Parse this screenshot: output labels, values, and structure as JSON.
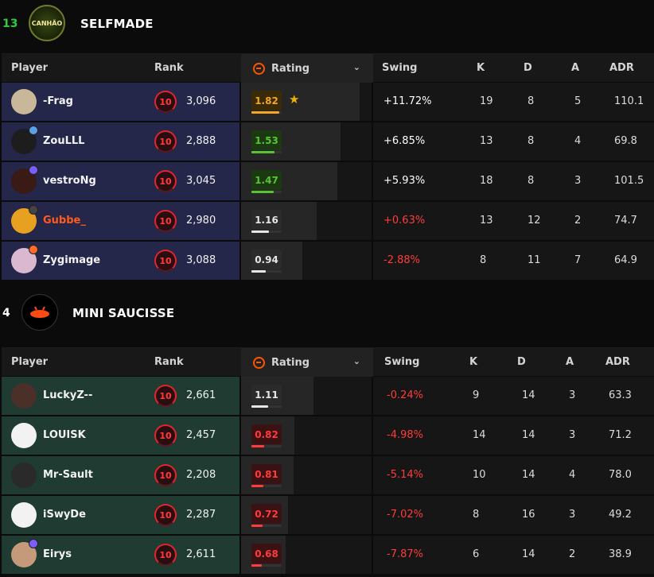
{
  "teams": [
    {
      "score": "13",
      "score_color": "#2ecc40",
      "logo_text": "CANHÃO",
      "name": "SELFMADE",
      "row_color": "#24264a",
      "headers": {
        "player": "Player",
        "rank": "Rank",
        "rating": "Rating",
        "swing": "Swing",
        "k": "K",
        "d": "D",
        "a": "A",
        "adr": "ADR"
      },
      "players": [
        {
          "name": "-Frag",
          "name_color": "#f2f2f2",
          "level": "10",
          "elo": "3,096",
          "rating": "1.82",
          "rating_tier": "gold",
          "star": "★",
          "swing": "+11.72%",
          "swing_sign": "pos",
          "k": "19",
          "d": "8",
          "a": "5",
          "adr": "110.1",
          "avatar_color": "#c9b79a",
          "badge_color": ""
        },
        {
          "name": "ZouLLL",
          "name_color": "#f2f2f2",
          "level": "10",
          "elo": "2,888",
          "rating": "1.53",
          "rating_tier": "green",
          "star": "",
          "swing": "+6.85%",
          "swing_sign": "pos",
          "k": "13",
          "d": "8",
          "a": "4",
          "adr": "69.8",
          "avatar_color": "#1d1d1d",
          "badge_color": "#5aa0e6"
        },
        {
          "name": "vestroNg",
          "name_color": "#f2f2f2",
          "level": "10",
          "elo": "3,045",
          "rating": "1.47",
          "rating_tier": "green",
          "star": "",
          "swing": "+5.93%",
          "swing_sign": "pos",
          "k": "18",
          "d": "8",
          "a": "3",
          "adr": "101.5",
          "avatar_color": "#3a1a14",
          "badge_color": "#7b5cff"
        },
        {
          "name": "Gubbe_",
          "name_color": "#ff5a1f",
          "level": "10",
          "elo": "2,980",
          "rating": "1.16",
          "rating_tier": "neutral",
          "star": "",
          "swing": "+0.63%",
          "swing_sign": "neg",
          "k": "13",
          "d": "12",
          "a": "2",
          "adr": "74.7",
          "avatar_color": "#e8a020",
          "badge_color": "#444"
        },
        {
          "name": "Zygimage",
          "name_color": "#f2f2f2",
          "level": "10",
          "elo": "3,088",
          "rating": "0.94",
          "rating_tier": "neutral",
          "star": "",
          "swing": "-2.88%",
          "swing_sign": "neg",
          "k": "8",
          "d": "11",
          "a": "7",
          "adr": "64.9",
          "avatar_color": "#d9b8d0",
          "badge_color": "#ff6a2a"
        }
      ]
    },
    {
      "score": "4",
      "score_color": "#ffffff",
      "logo_text": "",
      "name": "MINI SAUCISSE",
      "row_color": "#1f3b32",
      "headers": {
        "player": "Player",
        "rank": "Rank",
        "rating": "Rating",
        "swing": "Swing",
        "k": "K",
        "d": "D",
        "a": "A",
        "adr": "ADR"
      },
      "players": [
        {
          "name": "LuckyZ--",
          "name_color": "#f2f2f2",
          "level": "10",
          "elo": "2,661",
          "rating": "1.11",
          "rating_tier": "neutral",
          "star": "",
          "swing": "-0.24%",
          "swing_sign": "neg",
          "k": "9",
          "d": "14",
          "a": "3",
          "adr": "63.3",
          "avatar_color": "#4a3028",
          "badge_color": ""
        },
        {
          "name": "LOUISK",
          "name_color": "#f2f2f2",
          "level": "10",
          "elo": "2,457",
          "rating": "0.82",
          "rating_tier": "red",
          "star": "",
          "swing": "-4.98%",
          "swing_sign": "neg",
          "k": "14",
          "d": "14",
          "a": "3",
          "adr": "71.2",
          "avatar_color": "#f2f2f2",
          "badge_color": ""
        },
        {
          "name": "Mr-Sault",
          "name_color": "#f2f2f2",
          "level": "10",
          "elo": "2,208",
          "rating": "0.81",
          "rating_tier": "red",
          "star": "",
          "swing": "-5.14%",
          "swing_sign": "neg",
          "k": "10",
          "d": "14",
          "a": "4",
          "adr": "78.0",
          "avatar_color": "#2a2a2a",
          "badge_color": ""
        },
        {
          "name": "iSwyDe",
          "name_color": "#f2f2f2",
          "level": "10",
          "elo": "2,287",
          "rating": "0.72",
          "rating_tier": "red",
          "star": "",
          "swing": "-7.02%",
          "swing_sign": "neg",
          "k": "8",
          "d": "16",
          "a": "3",
          "adr": "49.2",
          "avatar_color": "#f2f2f2",
          "badge_color": ""
        },
        {
          "name": "Eirys",
          "name_color": "#f2f2f2",
          "level": "10",
          "elo": "2,611",
          "rating": "0.68",
          "rating_tier": "red",
          "star": "",
          "swing": "-7.87%",
          "swing_sign": "neg",
          "k": "6",
          "d": "14",
          "a": "2",
          "adr": "38.9",
          "avatar_color": "#c49a7a",
          "badge_color": "#7b5cff"
        }
      ]
    }
  ],
  "colors": {
    "gold": "#f5a623",
    "green": "#5bc236",
    "neutral": "#e6e6e6",
    "red": "#ff3b3b",
    "accent": "#ff5500"
  }
}
